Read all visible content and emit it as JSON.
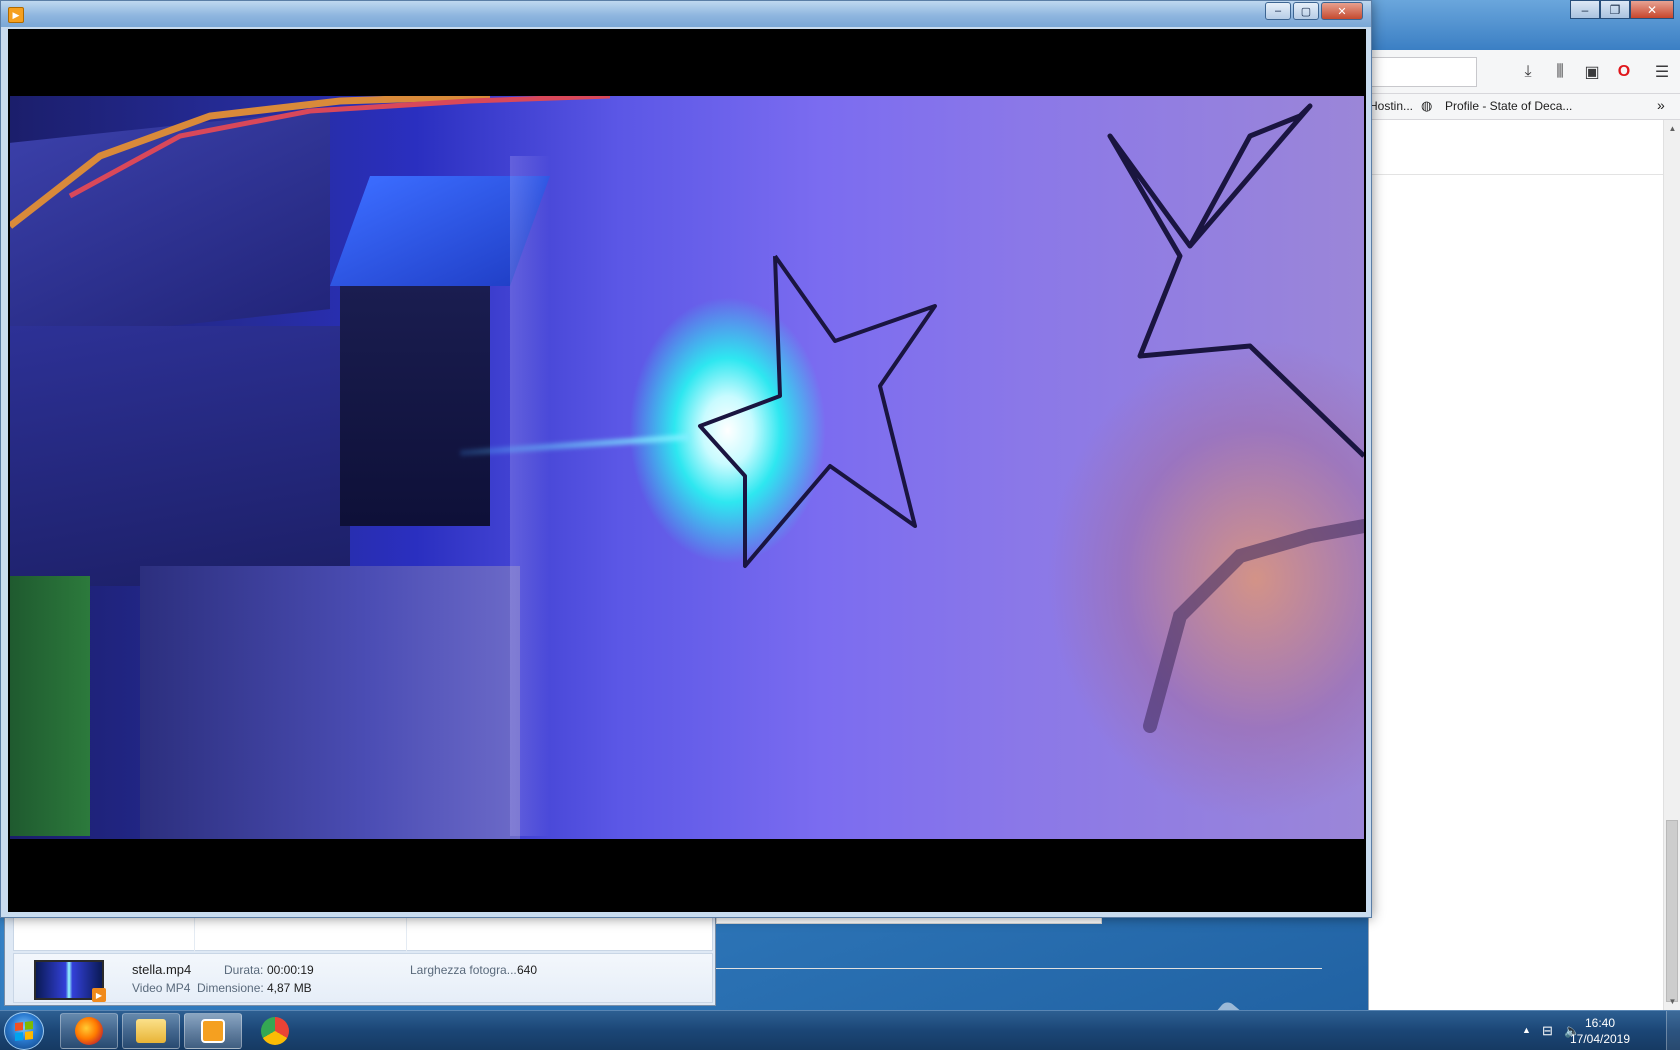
{
  "firefox": {
    "bookmarks": [
      {
        "label": "Hostin..."
      },
      {
        "label": "Profile - State of Deca..."
      }
    ],
    "icons": [
      "download-icon",
      "library-icon",
      "sidebar-icon",
      "opera-icon",
      "menu-icon",
      "overflow-chevron-icon",
      "globe-icon"
    ]
  },
  "player": {
    "title": "",
    "caption": {
      "minimize": "–",
      "maximize": "▢",
      "close": "✕"
    }
  },
  "explorer": {
    "file_name": "stella.mp4",
    "file_type": "Video MP4",
    "duration_label": "Durata:",
    "duration_value": "00:00:19",
    "size_label": "Dimensione:",
    "size_value": "4,87 MB",
    "width_label": "Larghezza fotogra...",
    "width_value": "640"
  },
  "taskbar": {
    "apps": [
      {
        "name": "firefox",
        "color": "#e66000"
      },
      {
        "name": "explorer",
        "color": "#f3c34a"
      },
      {
        "name": "media-player",
        "color": "#f5a020"
      },
      {
        "name": "chrome",
        "color": "#4285f4"
      }
    ],
    "clock_time": "16:40",
    "clock_date": "17/04/2019"
  },
  "colors": {
    "taskbar": "#1b4676",
    "video_glow": "#2ee7f0",
    "laser_blue": "#2a2fc0"
  }
}
